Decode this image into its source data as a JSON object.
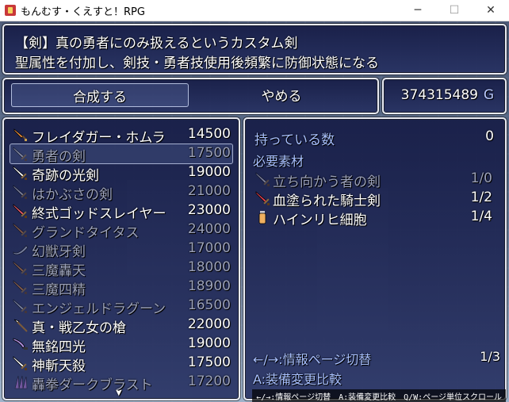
{
  "window": {
    "title": "もんむす・くえすと！RPG",
    "minimize": "─",
    "maximize": "☐",
    "close": "✕"
  },
  "help": {
    "line1": "【剣】真の勇者にのみ扱えるというカスタム剣",
    "line2": "聖属性を付加し、剣技・勇者技使用後頻繁に防御状態になる"
  },
  "commands": {
    "synthesize": "合成する",
    "cancel": "やめる"
  },
  "gold": {
    "value": "374315489",
    "unit": "G"
  },
  "items": [
    {
      "name": "フレイダガー・ホムラ",
      "price": "14500",
      "enabled": true,
      "icon": "dagger-icon",
      "color": "#e0883a"
    },
    {
      "name": "勇者の剣",
      "price": "17500",
      "enabled": false,
      "selected": true,
      "icon": "sword-icon",
      "color": "#d8d8e0"
    },
    {
      "name": "奇跡の光剣",
      "price": "19000",
      "enabled": true,
      "icon": "sword-icon",
      "color": "#ffffff"
    },
    {
      "name": "はかぶさの剣",
      "price": "21000",
      "enabled": false,
      "icon": "sword-icon",
      "color": "#d8d8e0"
    },
    {
      "name": "終式ゴッドスレイヤー",
      "price": "23000",
      "enabled": true,
      "icon": "sword-icon",
      "color": "#e85a6a"
    },
    {
      "name": "グランドタイタス",
      "price": "24000",
      "enabled": false,
      "icon": "sword-icon",
      "color": "#e0883a"
    },
    {
      "name": "幻獣牙剣",
      "price": "17000",
      "enabled": false,
      "icon": "fang-sword-icon",
      "color": "#c8d0e0"
    },
    {
      "name": "三魔轟天",
      "price": "18000",
      "enabled": false,
      "icon": "sword-icon",
      "color": "#e0883a"
    },
    {
      "name": "三魔四精",
      "price": "18900",
      "enabled": false,
      "icon": "sword-icon",
      "color": "#e0883a"
    },
    {
      "name": "エンジェルドラグーン",
      "price": "16500",
      "enabled": false,
      "icon": "sword-icon",
      "color": "#c8d0e0"
    },
    {
      "name": "真・戦乙女の槍",
      "price": "22000",
      "enabled": true,
      "icon": "spear-icon",
      "color": "#ffffff"
    },
    {
      "name": "無銘四光",
      "price": "19000",
      "enabled": true,
      "icon": "katana-icon",
      "color": "#b090e0"
    },
    {
      "name": "神斬天殺",
      "price": "17500",
      "enabled": true,
      "icon": "sword-icon",
      "color": "#ffffff"
    },
    {
      "name": "轟拳ダークブラスト",
      "price": "17200",
      "enabled": false,
      "icon": "claw-icon",
      "color": "#b070d0"
    }
  ],
  "info": {
    "owned_label": "持っている数",
    "owned_value": "0",
    "required_label": "必要素材",
    "materials": [
      {
        "name": "立ち向かう者の剣",
        "count": "1/0",
        "enabled": false,
        "icon": "sword-icon",
        "color": "#d8d8e0"
      },
      {
        "name": "血塗られた騎士剣",
        "count": "1/2",
        "enabled": true,
        "icon": "sword-icon",
        "color": "#e04050"
      },
      {
        "name": "ハインリヒ細胞",
        "count": "1/4",
        "enabled": true,
        "icon": "vial-icon",
        "color": "#f0b060"
      }
    ],
    "page_help": "←/→:情報ページ切替",
    "page_number": "1/3",
    "compare_help": "A:装備変更比較"
  },
  "key_help": "←/→:情報ページ切替　A:装備変更比較　Q/W:ページ単位スクロール"
}
